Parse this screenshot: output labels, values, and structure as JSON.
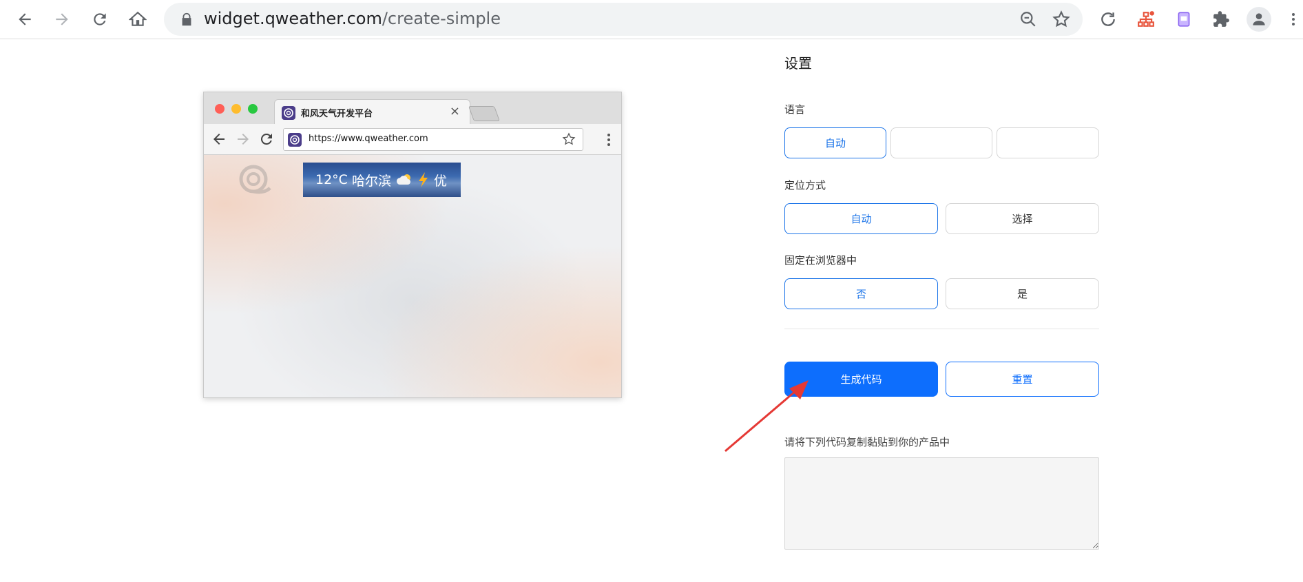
{
  "browser": {
    "url_host": "widget.qweather.com",
    "url_path": "/create-simple",
    "icons": {
      "back": "back-arrow-icon",
      "forward": "forward-arrow-icon",
      "reload": "reload-icon",
      "home": "home-icon",
      "lock": "lock-icon",
      "zoom": "zoom-out-icon",
      "bookmark": "star-icon",
      "sync": "refresh-extension-icon",
      "ext1": "sitemap-extension-icon",
      "ext2": "note-extension-icon",
      "extensions": "puzzle-icon",
      "profile": "profile-icon",
      "menu": "more-vert-icon"
    }
  },
  "preview": {
    "tab_title": "和风天气开发平台",
    "tab_close": "×",
    "address": "https://www.qweather.com",
    "widget": {
      "temperature": "12°C",
      "city": "哈尔滨",
      "air_quality": "优"
    }
  },
  "settings": {
    "title": "设置",
    "language": {
      "label": "语言",
      "options": [
        "自动",
        "",
        ""
      ],
      "selected": "自动"
    },
    "location": {
      "label": "定位方式",
      "options": [
        "自动",
        "选择"
      ],
      "selected": "自动"
    },
    "fixed": {
      "label": "固定在浏览器中",
      "options": [
        "否",
        "是"
      ],
      "selected": "否"
    },
    "generate_button": "生成代码",
    "reset_button": "重置",
    "code_label": "请将下列代码复制黏贴到你的产品中",
    "code_value": ""
  },
  "colors": {
    "accent": "#0d6efd",
    "annotation_arrow": "#e53935"
  }
}
